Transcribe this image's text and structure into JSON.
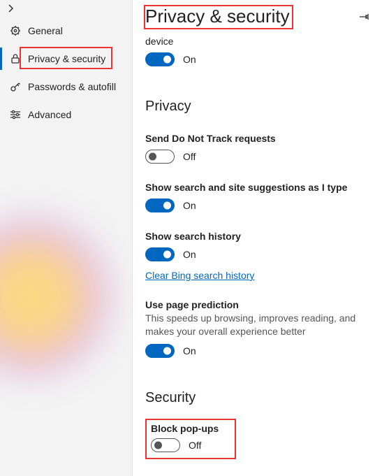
{
  "sidebar": {
    "items": [
      {
        "label": "General"
      },
      {
        "label": "Privacy & security"
      },
      {
        "label": "Passwords & autofill"
      },
      {
        "label": "Advanced"
      }
    ]
  },
  "page": {
    "title": "Privacy & security",
    "prev_fragment": "device"
  },
  "settings": {
    "device_toggle": {
      "state": "On"
    },
    "privacy_heading": "Privacy",
    "dnt": {
      "title": "Send Do Not Track requests",
      "state": "Off"
    },
    "suggest": {
      "title": "Show search and site suggestions as I type",
      "state": "On"
    },
    "history": {
      "title": "Show search history",
      "state": "On",
      "link": "Clear Bing search history"
    },
    "predict": {
      "title": "Use page prediction",
      "desc": "This speeds up browsing, improves reading, and makes your overall experience better",
      "state": "On"
    },
    "security_heading": "Security",
    "popups": {
      "title": "Block pop-ups",
      "state": "Off"
    }
  }
}
